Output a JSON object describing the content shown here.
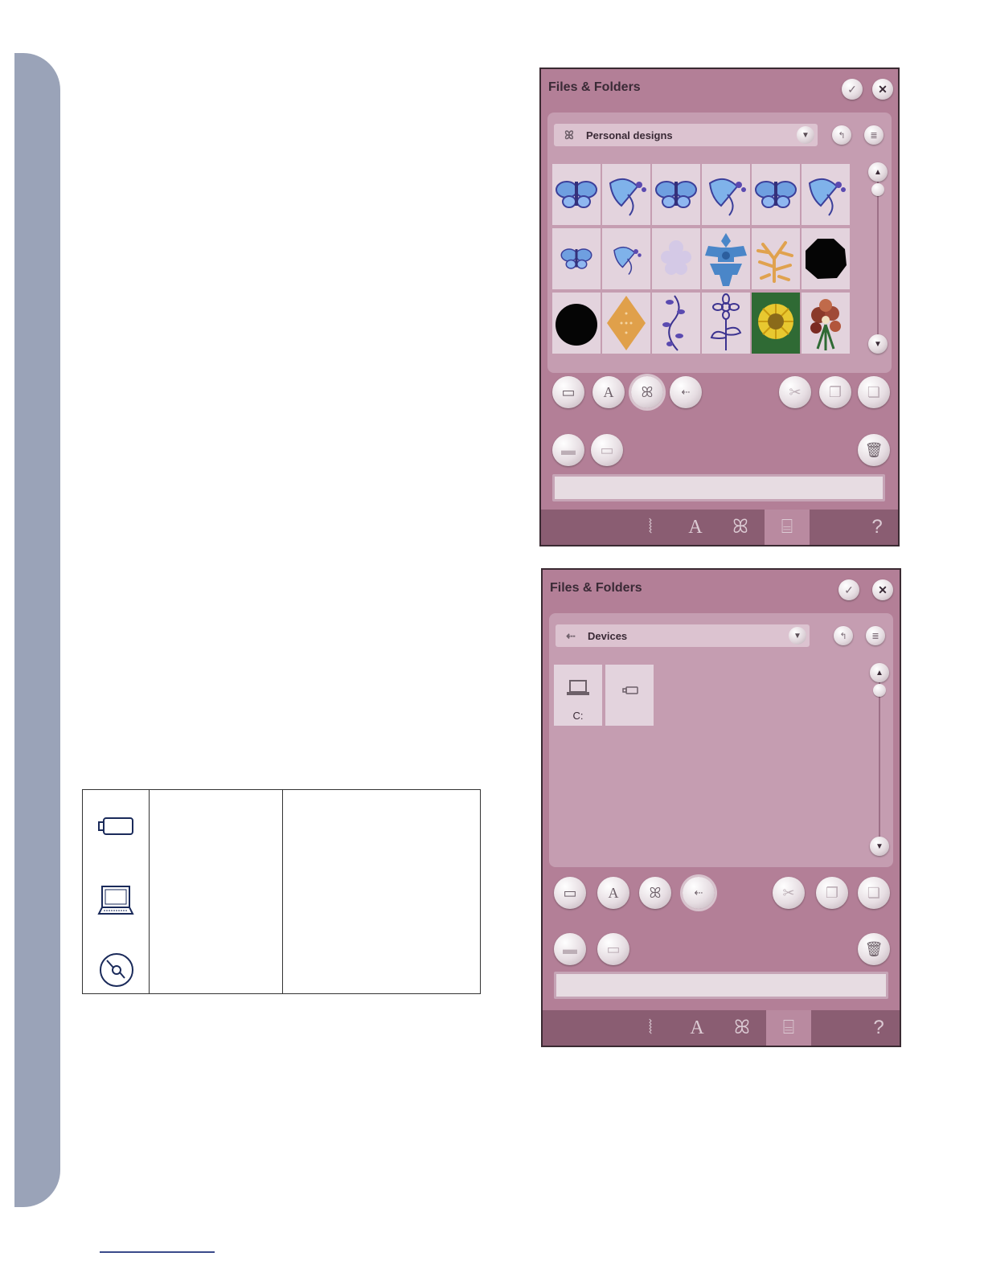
{
  "panel1": {
    "title": "Files & Folders",
    "confirm_icon": "check-icon",
    "close_icon": "close-icon",
    "location": {
      "label": "Personal designs",
      "icon": "butterfly-icon"
    },
    "grid_designs": [
      "butterfly-design-1",
      "lily-design-1",
      "butterfly-design-2",
      "lily-design-2",
      "butterfly-design-3",
      "lily-design-3",
      "butterfly-design-small",
      "lily-design-small",
      "faded-flower-design",
      "blue-ornament-design",
      "coral-design",
      "black-octagon-design",
      "black-circle-design",
      "gold-diamond-design",
      "vine-design",
      "flower-stem-design",
      "sunflower-design",
      "bouquet-design"
    ],
    "active_tab": "embroidery-designs"
  },
  "panel2": {
    "title": "Files & Folders",
    "confirm_icon": "check-icon",
    "close_icon": "close-icon",
    "location": {
      "label": "Devices",
      "icon": "usb-icon"
    },
    "devices": [
      {
        "name": "computer-device",
        "label": "C:"
      },
      {
        "name": "usb-stick-device",
        "label": ""
      }
    ],
    "active_tab": "usb-devices"
  },
  "icon_table": {
    "icons": [
      "usb-stick-icon",
      "laptop-icon",
      "cd-icon"
    ]
  }
}
